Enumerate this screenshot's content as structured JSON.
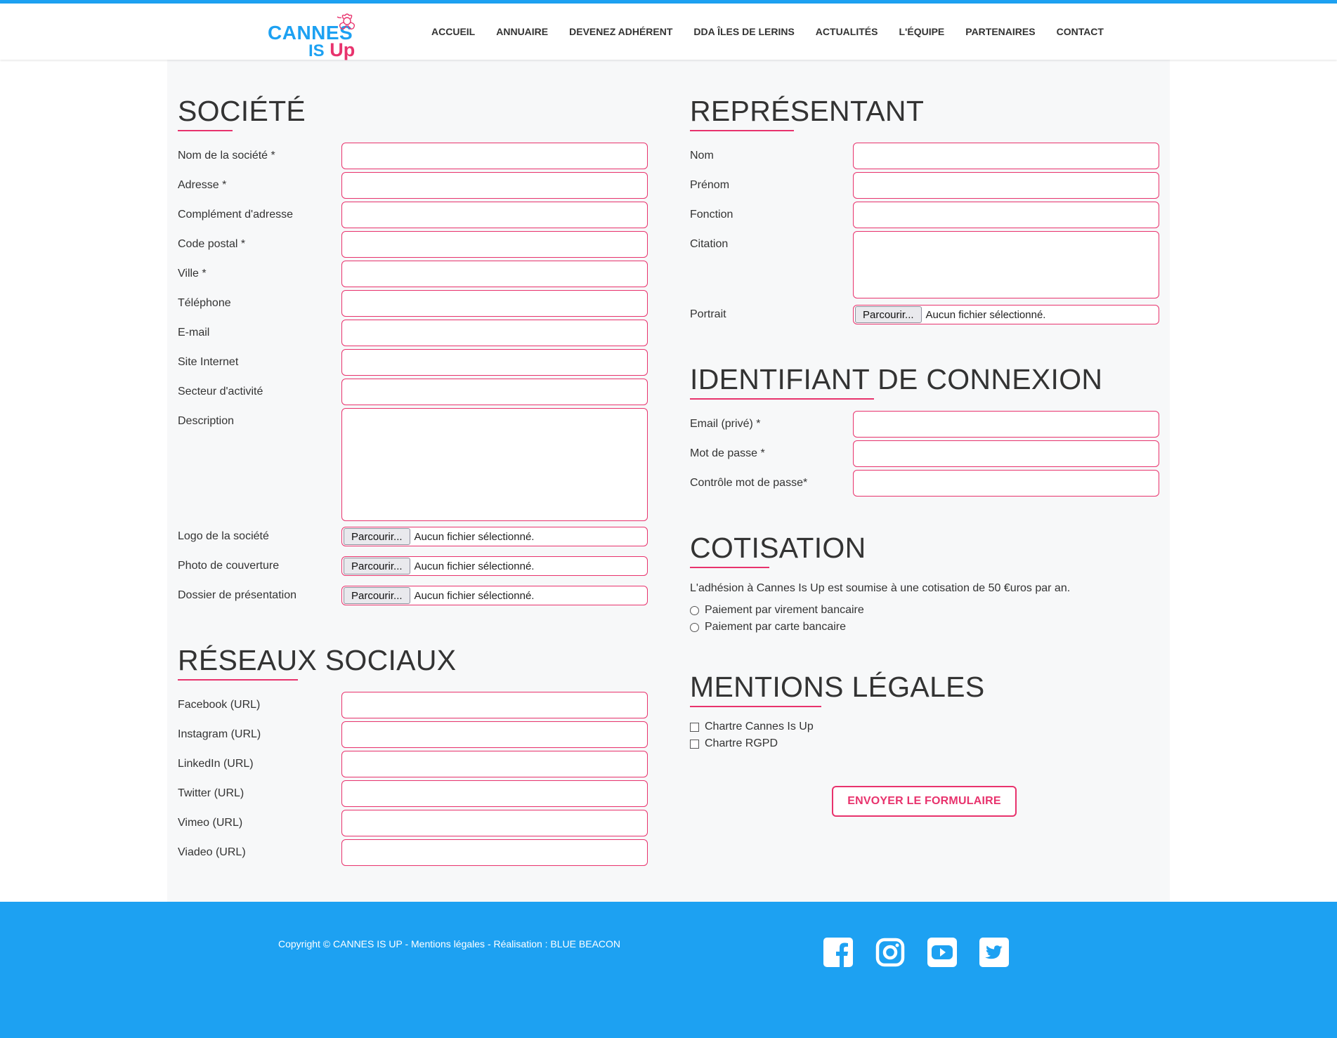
{
  "brand": {
    "name_line1": "CANNES",
    "name_is": "IS",
    "name_up": "Up",
    "primary_color": "#1da1f2",
    "accent_color": "#e8336d"
  },
  "nav": {
    "items": [
      "ACCUEIL",
      "ANNUAIRE",
      "DEVENEZ ADHÉRENT",
      "DDA ÎLES DE LERINS",
      "ACTUALITÉS",
      "L'ÉQUIPE",
      "PARTENAIRES",
      "CONTACT"
    ]
  },
  "societe": {
    "title": "SOCIÉTÉ",
    "fields": [
      "Nom de la société *",
      "Adresse *",
      "Complément d'adresse",
      "Code postal *",
      "Ville *",
      "Téléphone",
      "E-mail",
      "Site Internet",
      "Secteur d'activité",
      "Description"
    ],
    "files": [
      "Logo de la société",
      "Photo de couverture",
      "Dossier de présentation"
    ]
  },
  "file_input": {
    "button": "Parcourir...",
    "empty": "Aucun fichier sélectionné."
  },
  "reseaux": {
    "title": "RÉSEAUX SOCIAUX",
    "fields": [
      "Facebook (URL)",
      "Instagram (URL)",
      "LinkedIn (URL)",
      "Twitter (URL)",
      "Vimeo (URL)",
      "Viadeo (URL)"
    ]
  },
  "representant": {
    "title": "REPRÉSENTANT",
    "fields": [
      "Nom",
      "Prénom",
      "Fonction",
      "Citation"
    ],
    "portrait_label": "Portrait"
  },
  "identifiant": {
    "title": "IDENTIFIANT DE CONNEXION",
    "fields": [
      "Email (privé) *",
      "Mot de passe *",
      "Contrôle mot de passe*"
    ]
  },
  "cotisation": {
    "title": "COTISATION",
    "text": "L'adhésion à Cannes Is Up est soumise à une cotisation de 50 €uros par an.",
    "options": [
      "Paiement par virement bancaire",
      "Paiement par carte bancaire"
    ]
  },
  "mentions": {
    "title": "MENTIONS LÉGALES",
    "checks": [
      "Chartre Cannes Is Up",
      "Chartre RGPD"
    ]
  },
  "submit": {
    "label": "ENVOYER LE FORMULAIRE"
  },
  "footer": {
    "copyright": "Copyright © CANNES IS UP - Mentions légales - Réalisation : BLUE BEACON",
    "icons": [
      "facebook-icon",
      "instagram-icon",
      "youtube-icon",
      "twitter-icon"
    ]
  }
}
